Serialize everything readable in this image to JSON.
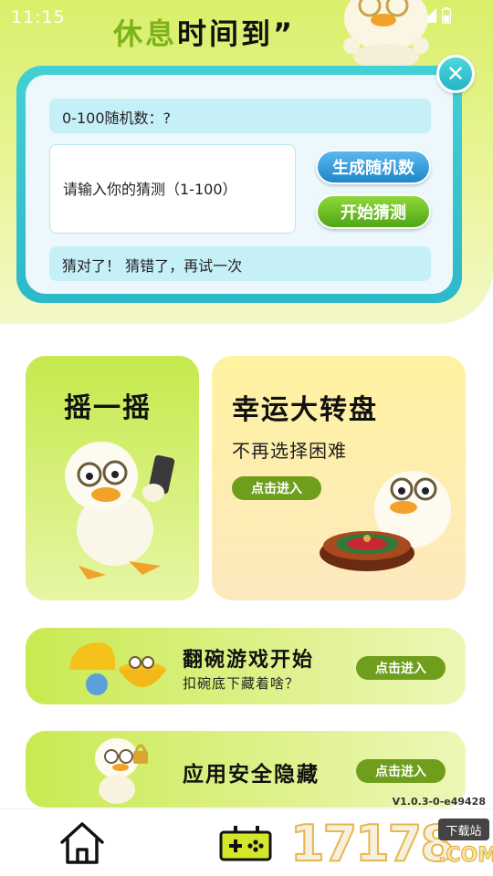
{
  "status_bar": {
    "time": "11:15"
  },
  "title": {
    "part1": "休息",
    "part2": "时间到”"
  },
  "guess_game": {
    "random_label": "0-100随机数：?",
    "input_placeholder": "请输入你的猜测（1-100）",
    "generate_button": "生成随机数",
    "start_button": "开始猜测",
    "result_text": "猜对了！ 猜错了，再试一次"
  },
  "cards": {
    "shake": {
      "title": "摇一摇"
    },
    "wheel": {
      "title": "幸运大转盘",
      "subtitle": "不再选择困难",
      "enter": "点击进入"
    },
    "bowl": {
      "title": "翻碗游戏开始",
      "subtitle": "扣碗底下藏着啥？",
      "enter": "点击进入"
    },
    "hide": {
      "title": "应用安全隐藏",
      "enter": "点击进入"
    }
  },
  "version": "V1.0.3-0-e49428",
  "watermark": {
    "number": "17178",
    "tag": "下载站",
    "domain": ".COM"
  },
  "icons": {
    "home": "home-icon",
    "game": "gamepad-icon",
    "close": "close-icon"
  },
  "colors": {
    "accent_green": "#7cb31a",
    "panel_teal": "#2cb9c9",
    "button_blue": "#1e86cc",
    "button_green": "#4ea615",
    "enter_button": "#6f9e1d"
  }
}
